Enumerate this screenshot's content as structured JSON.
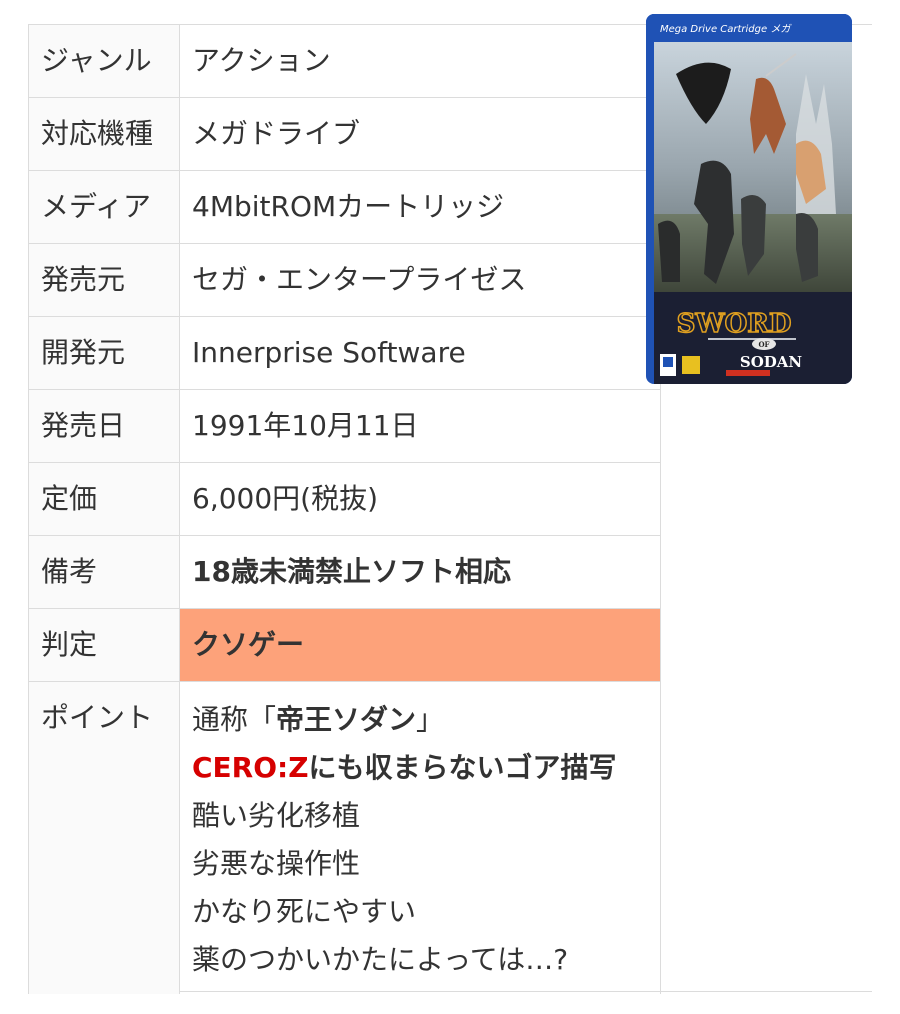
{
  "rows": [
    {
      "label": "ジャンル",
      "value": "アクション"
    },
    {
      "label": "対応機種",
      "value": "メガドライブ"
    },
    {
      "label": "メディア",
      "value": "4MbitROMカートリッジ"
    },
    {
      "label": "発売元",
      "value": "セガ・エンタープライゼス"
    },
    {
      "label": "開発元",
      "value": "Innerprise Software"
    },
    {
      "label": "発売日",
      "value": "1991年10月11日"
    },
    {
      "label": "定価",
      "value": "6,000円(税抜)"
    },
    {
      "label": "備考",
      "value": "18歳未満禁止ソフト相応"
    },
    {
      "label": "判定",
      "value": "クソゲー"
    }
  ],
  "points": {
    "label": "ポイント",
    "line1": {
      "pre": "通称「",
      "bold": "帝王ソダン",
      "post": "」"
    },
    "line2": {
      "red": "CERO:Z",
      "bold": "にも収まらないゴア描写"
    },
    "line3": "酷い劣化移植",
    "line4": "劣悪な操作性",
    "line5": "かなり死にやすい",
    "line6": "薬のつかいかたによっては…?"
  },
  "cover": {
    "header": "Mega Drive Cartridge メガ",
    "title_sword": "SWORD",
    "title_of": "OF",
    "title_sodan": "SODAN"
  },
  "colors": {
    "judgement_bg": "#fda27a",
    "warning_text": "#d20f3c",
    "cero_red": "#d60000",
    "cover_frame": "#1f52b5"
  }
}
